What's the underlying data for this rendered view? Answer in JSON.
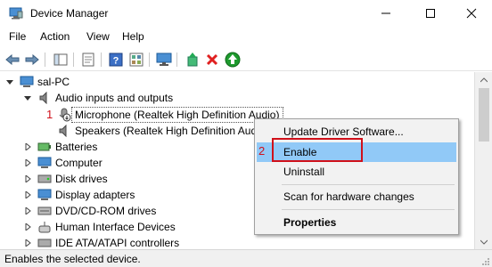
{
  "window": {
    "title": "Device Manager",
    "controls": [
      "minimize-icon",
      "maximize-icon",
      "close-icon"
    ]
  },
  "menu": {
    "items": [
      "File",
      "Action",
      "View",
      "Help"
    ]
  },
  "toolbar": {
    "buttons": [
      "back-icon",
      "forward-icon",
      "show-hide-tree-icon",
      "properties-icon",
      "help-icon",
      "details-icon",
      "monitor-icon",
      "update-driver-icon",
      "uninstall-icon",
      "enable-device-icon"
    ]
  },
  "tree": {
    "root": "sal-PC",
    "audio_group": "Audio inputs and outputs",
    "audio_children": [
      "Microphone (Realtek High Definition Audio)",
      "Speakers (Realtek High Definition Audio)"
    ],
    "categories": [
      "Batteries",
      "Computer",
      "Disk drives",
      "Display adapters",
      "DVD/CD-ROM drives",
      "Human Interface Devices",
      "IDE ATA/ATAPI controllers"
    ]
  },
  "annotations": {
    "step1": "1",
    "step2": "2",
    "accent_color": "#d0101a"
  },
  "context_menu": {
    "update": "Update Driver Software...",
    "enable": "Enable",
    "uninstall": "Uninstall",
    "scan": "Scan for hardware changes",
    "properties": "Properties",
    "highlight_color": "#91c9f7"
  },
  "status": {
    "text": "Enables the selected device."
  }
}
